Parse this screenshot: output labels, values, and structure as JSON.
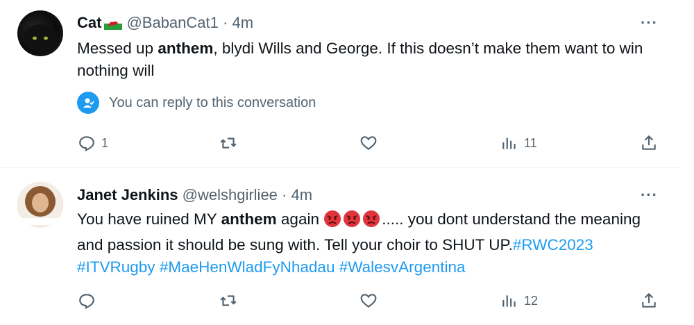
{
  "tweets": [
    {
      "name": "Cat",
      "handle": "@BabanCat1",
      "separator": "·",
      "time": "4m",
      "text_parts": [
        "Messed up ",
        "anthem",
        ", blydi Wills and George. If this doesn’t make them want to win nothing will"
      ],
      "reply_note": "You can reply to this conversation",
      "reply_count": "1",
      "views": "11"
    },
    {
      "name": "Janet Jenkins",
      "handle": "@welshgirliee",
      "separator": "·",
      "time": "4m",
      "text_parts": [
        "You have ruined MY ",
        "anthem",
        " again ",
        "..... you dont understand the meaning and passion it should be sung with. Tell your choir to SHUT UP."
      ],
      "hashtags": [
        "#RWC2023",
        "#ITVRugby",
        "#MaeHenWladFyNhadau",
        "#WalesvArgentina"
      ],
      "views": "12"
    }
  ],
  "more_label": "···",
  "icons": [
    "reply-icon",
    "retweet-icon",
    "like-icon",
    "views-icon",
    "share-icon",
    "wales-flag-icon",
    "angry-face-icon",
    "more-icon",
    "user-check-icon"
  ],
  "colors": {
    "link": "#1d9bf0",
    "muted": "#536471",
    "text": "#0f1419",
    "divider": "#eff3f4"
  }
}
